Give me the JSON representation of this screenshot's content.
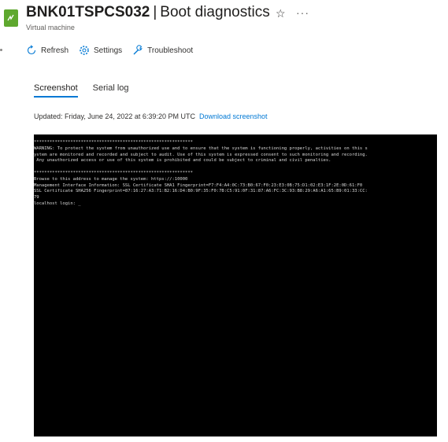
{
  "header": {
    "vm_name": "BNK01TSPCS032",
    "separator": "|",
    "page_title": "Boot diagnostics",
    "subtitle": "Virtual machine"
  },
  "toolbar": {
    "refresh_label": "Refresh",
    "settings_label": "Settings",
    "troubleshoot_label": "Troubleshoot"
  },
  "tabs": [
    {
      "label": "Screenshot",
      "active": true
    },
    {
      "label": "Serial log",
      "active": false
    }
  ],
  "updated": {
    "text": "Updated: Friday, June 24, 2022 at 6:39:20 PM UTC",
    "download_label": "Download screenshot"
  },
  "console": {
    "lines": [
      "*************************************************************",
      "WARNING: To protect the system from unauthorized use and to ensure that the system is functioning properly, activities on this s",
      "ystem are monitored and recorded and subject to audit. Use of this system is expressed consent to such monitoring and recording.",
      " Any unauthorized access or use of this system is prohibited and could be subject to criminal and civil penalties.",
      "",
      "*************************************************************",
      "Browse to this address to manage the system: https://:10000",
      "Management Interface Information: SSL Certificate SHA1 Fingerprint=F7:F4:A4:0C:73:B0:67:F0:23:E3:0B:75:D1:02:E3:1F:2E:0D:61:F0",
      "SSL Certificate SHA256 Fingerprint=87:16:27:A3:71:B2:16:D4:B0:9F:35:F0:7B:C5:91:0F:31:87:A6:FC:3C:93:B8:29:A6:A1:65:B9:01:33:CC:",
      "79",
      "localhost login: _"
    ]
  },
  "colors": {
    "accent": "#0078d4",
    "vm_icon": "#5ea82e",
    "console_bg": "#000000",
    "console_text": "#d8d8d8"
  },
  "icons": {
    "vm": "virtual-machine-icon",
    "favorite": "star-icon",
    "more": "more-icon",
    "refresh": "refresh-icon",
    "settings": "gear-icon",
    "troubleshoot": "wrench-icon"
  }
}
